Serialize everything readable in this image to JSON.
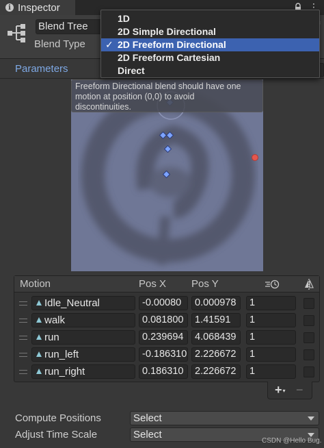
{
  "window": {
    "tab_title": "Inspector",
    "info_icon": "info-icon",
    "lock_icon": "lock-icon",
    "menu_icon": "vertical-dots-icon"
  },
  "header": {
    "name_value": "Blend Tree",
    "blend_type_label": "Blend Type",
    "icon": "blend-tree-icon"
  },
  "dropdown": {
    "items": [
      {
        "label": "1D",
        "selected": false
      },
      {
        "label": "2D Simple Directional",
        "selected": false
      },
      {
        "label": "2D Freeform Directional",
        "selected": true,
        "check": "✓"
      },
      {
        "label": "2D Freeform Cartesian",
        "selected": false
      },
      {
        "label": "Direct",
        "selected": false
      }
    ]
  },
  "parameters": {
    "tab_label": "Parameters"
  },
  "graph": {
    "warning_line1": "Freeform Directional blend should have one",
    "warning_line2": "motion at position (0,0) to avoid",
    "warning_line3": "discontinuities.",
    "background_color": "#6f7796",
    "sample_color": "#7da4ff",
    "outside_marker_color": "#e4574e"
  },
  "motion": {
    "headers": {
      "motion": "Motion",
      "pos_x": "Pos X",
      "pos_y": "Pos Y",
      "speed_icon": "time-speed-icon",
      "mirror_icon": "mirror-icon"
    },
    "rows": [
      {
        "clip": "Idle_Neutral",
        "pos_x": "-0.00080",
        "pos_y": "0.000978",
        "speed": "1"
      },
      {
        "clip": "walk",
        "pos_x": "0.081800",
        "pos_y": "1.41591",
        "speed": "1"
      },
      {
        "clip": "run",
        "pos_x": "0.239694",
        "pos_y": "4.068439",
        "speed": "1"
      },
      {
        "clip": "run_left",
        "pos_x": "-0.186310",
        "pos_y": "2.226672",
        "speed": "1"
      },
      {
        "clip": "run_right",
        "pos_x": "0.186310",
        "pos_y": "2.226672",
        "speed": "1"
      }
    ],
    "add_label": "+",
    "add_sub": "▾",
    "remove_label": "−"
  },
  "settings": {
    "compute_positions_label": "Compute Positions",
    "compute_positions_value": "Select",
    "adjust_time_scale_label": "Adjust Time Scale",
    "adjust_time_scale_value": "Select"
  },
  "watermark": "CSDN @Hello Bug."
}
